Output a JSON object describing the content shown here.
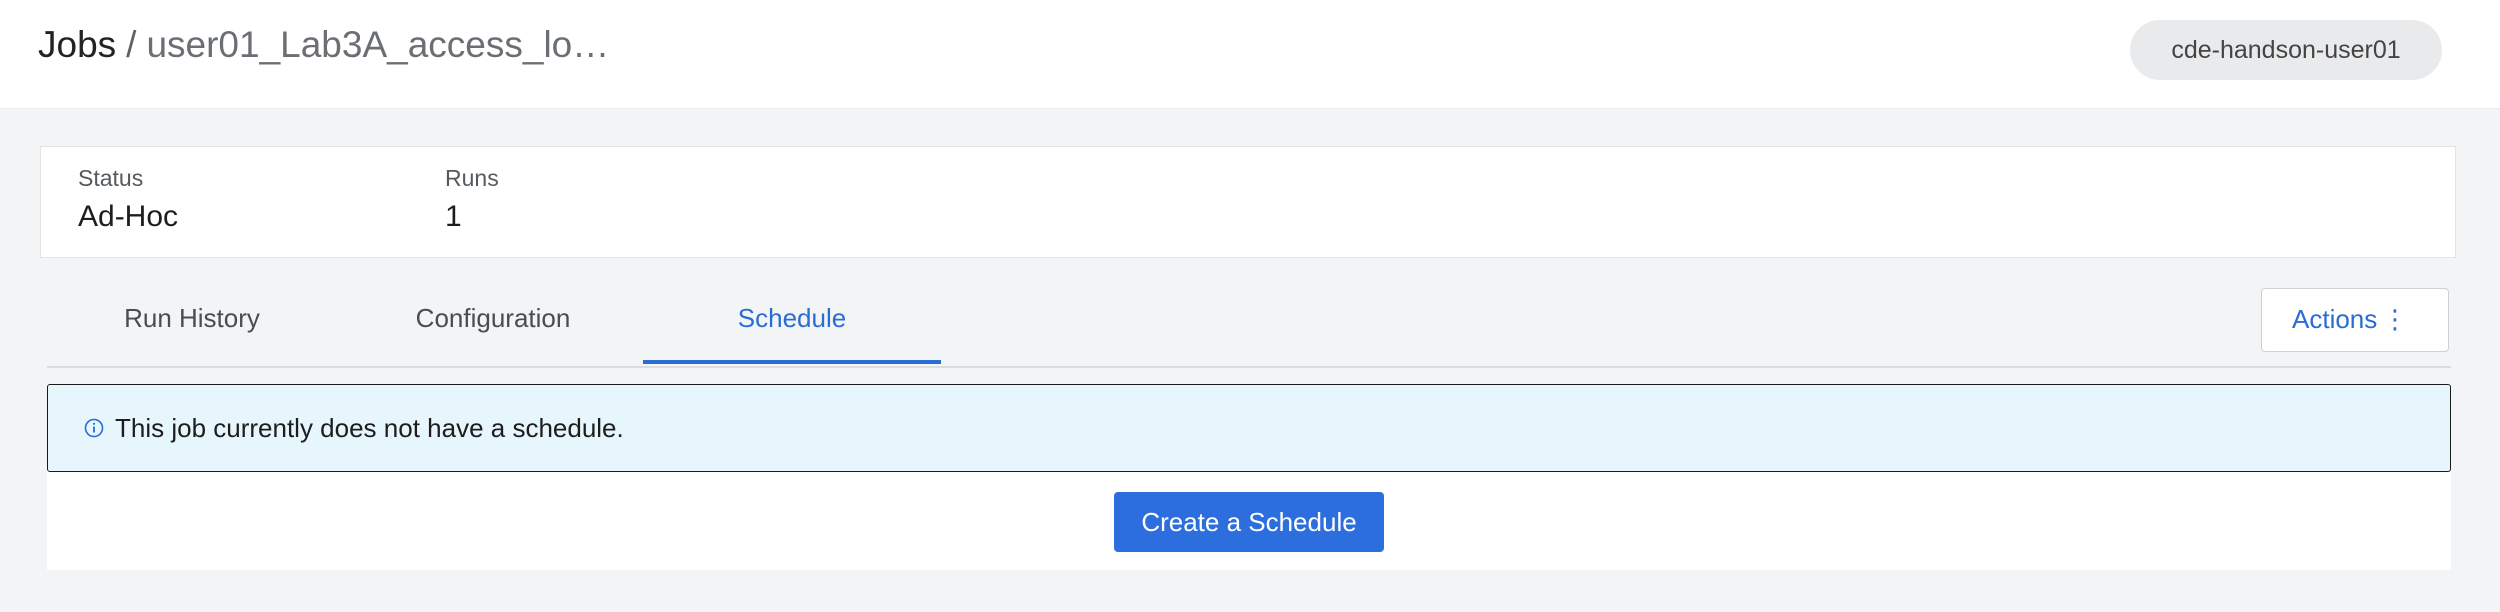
{
  "header": {
    "breadcrumb_root": "Jobs",
    "breadcrumb_separator": "/",
    "breadcrumb_current": "user01_Lab3A_access_lo…",
    "profile": "cde-handson-user01"
  },
  "summary": {
    "status_label": "Status",
    "status_value": "Ad-Hoc",
    "runs_label": "Runs",
    "runs_value": "1"
  },
  "tabs": [
    {
      "label": "Run History",
      "active": false
    },
    {
      "label": "Configuration",
      "active": false
    },
    {
      "label": "Schedule",
      "active": true
    }
  ],
  "actions": {
    "label": "Actions",
    "icon": "kebab-menu-icon"
  },
  "schedule": {
    "info_icon": "info-icon",
    "message": "This job currently does not have a schedule.",
    "create_button": "Create a Schedule"
  },
  "colors": {
    "accent": "#2a6cd6",
    "primary_button": "#2d6ede",
    "alert_background": "#e7f5fc",
    "page_background": "#f3f4f5"
  }
}
